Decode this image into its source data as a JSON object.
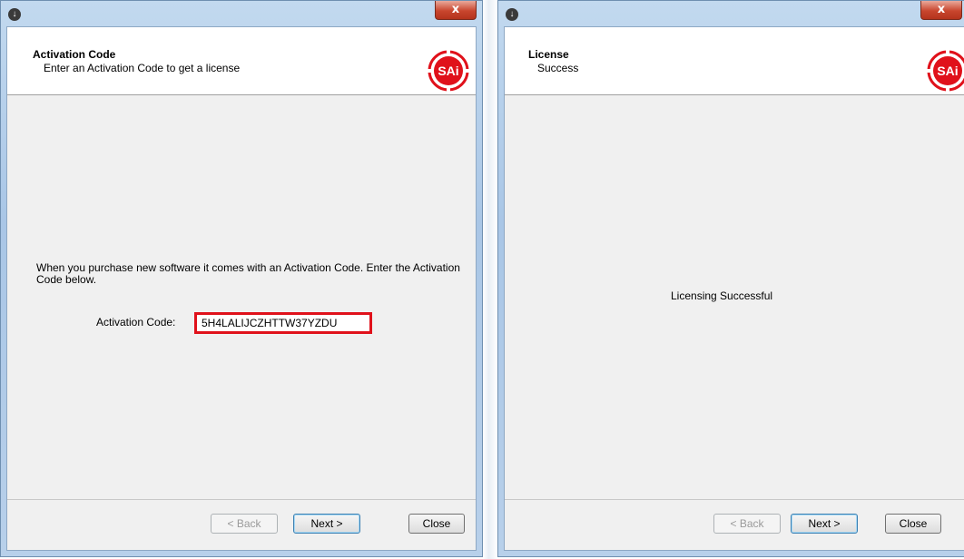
{
  "left_window": {
    "close_label": "x",
    "header_title": "Activation Code",
    "header_subtitle": "Enter an Activation Code to get a license",
    "logo_text": "SAi",
    "intro_text": "When you purchase new software it comes with an Activation Code.  Enter the Activation Code below.",
    "code_label": "Activation Code:",
    "code_value": "5H4LALIJCZHTTW37YZDU",
    "buttons": {
      "back": "< Back",
      "next": "Next >",
      "close": "Close"
    }
  },
  "right_window": {
    "close_label": "x",
    "header_title": "License",
    "header_subtitle": "Success",
    "logo_text": "SAi",
    "status_text": "Licensing Successful",
    "buttons": {
      "back": "< Back",
      "next": "Next >",
      "close": "Close"
    }
  },
  "colors": {
    "logo_red": "#e0111b",
    "highlight_border": "#e0111b",
    "close_button": "#c8462e"
  }
}
